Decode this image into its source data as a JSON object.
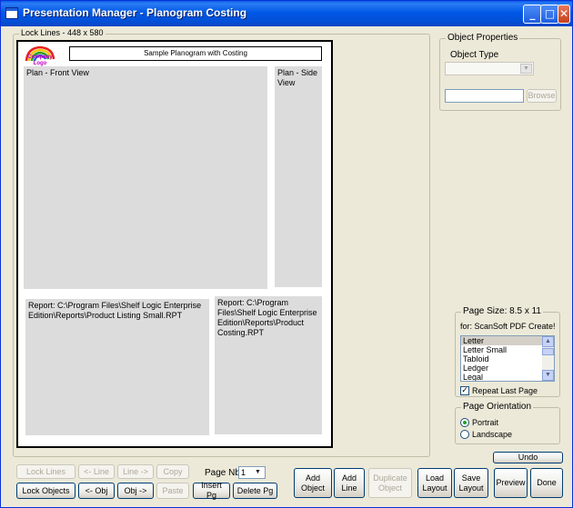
{
  "window": {
    "title": "Presentation Manager - Planogram Costing",
    "minimize_glyph": "_",
    "maximize_glyph": "□",
    "close_glyph": "✕"
  },
  "layout_area": {
    "lock_lines_label": "Lock Lines - 448 x 580",
    "canvas": {
      "logo_text": "Company Logo",
      "title": "Sample Planogram with Costing",
      "front_view_label": "Plan - Front View",
      "side_view_label": "Plan - Side View",
      "report1_label": "Report: C:\\Program Files\\Shelf Logic Enterprise Edition\\Reports\\Product Listing Small.RPT",
      "report2_label": "Report: C:\\Program Files\\Shelf Logic Enterprise Edition\\Reports\\Product Costing.RPT"
    }
  },
  "object_properties": {
    "group_label": "Object Properties",
    "object_type_label": "Object Type",
    "object_type_value": "",
    "path_value": "",
    "browse_label": "Browse"
  },
  "page_size": {
    "group_label": "Page Size: 8.5 x 11",
    "printer_label": "for: ScanSoft PDF Create!",
    "options": [
      "Letter",
      "Letter Small",
      "Tabloid",
      "Ledger",
      "Legal"
    ],
    "selected": "Letter",
    "repeat_last_page_label": "Repeat Last Page",
    "repeat_last_page_checked": true
  },
  "page_orientation": {
    "group_label": "Page Orientation",
    "portrait_label": "Portrait",
    "landscape_label": "Landscape",
    "selected": "Portrait"
  },
  "toolbar": {
    "undo": "Undo",
    "lock_lines": "Lock Lines",
    "prev_line": "<- Line",
    "next_line": "Line ->",
    "copy": "Copy",
    "page_nbr_label": "Page Nbr",
    "page_nbr_value": "1",
    "lock_objects": "Lock Objects",
    "prev_obj": "<- Obj",
    "next_obj": "Obj ->",
    "paste": "Paste",
    "insert_pg": "Insert Pg",
    "delete_pg": "Delete Pg",
    "add_object": "Add Object",
    "add_line": "Add Line",
    "duplicate_object": "Duplicate Object",
    "load_layout": "Load Layout",
    "save_layout": "Save Layout",
    "preview": "Preview",
    "done": "Done"
  },
  "colors": {
    "titlebar": "#0058e6",
    "window_bg": "#ece9d8",
    "panel_gray": "#dcdcdc",
    "button_border": "#003c74"
  }
}
